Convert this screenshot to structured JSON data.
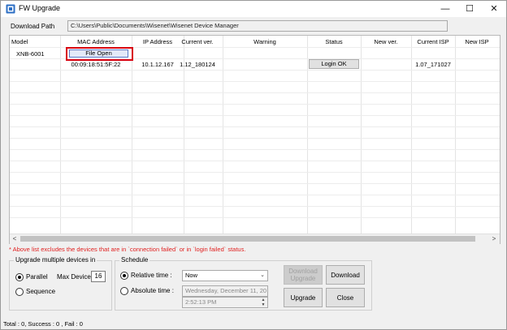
{
  "window": {
    "title": "FW Upgrade",
    "minimize_glyph": "—",
    "maximize_glyph": "☐",
    "close_glyph": "✕",
    "icon": "app-icon"
  },
  "download_path": {
    "label": "Download Path",
    "value": "C:\\Users\\Public\\Documents\\Wisenet\\Wisenet Device Manager"
  },
  "table": {
    "headers": [
      "Model",
      "MAC Address",
      "IP Address",
      "Current ver.",
      "Warning",
      "Status",
      "New ver.",
      "Current ISP",
      "New ISP"
    ],
    "row": {
      "model": "XNB-6001",
      "file_open_label": "File Open",
      "mac": "00:09:18:51:5F:22",
      "ip": "10.1.12.167",
      "current_ver": "1.12_180124",
      "status_button": "Login OK",
      "current_isp": "1.07_171027"
    },
    "scroll_left_glyph": "<",
    "scroll_right_glyph": ">"
  },
  "warning_note": "* Above list excludes the devices that are in `connection failed` or in `login failed` status.",
  "upgrade_group": {
    "title": "Upgrade multiple devices in",
    "parallel_label": "Parallel",
    "parallel_selected": true,
    "max_device_label": "Max Device",
    "max_device_value": "16",
    "sequence_label": "Sequence"
  },
  "schedule_group": {
    "title": "Schedule",
    "relative_label": "Relative time :",
    "relative_selected": true,
    "relative_value": "Now",
    "absolute_label": "Absolute time :",
    "absolute_date": "Wednesday,  December 11, 20",
    "absolute_time": "2:52:13 PM",
    "dropdown_glyph": "⌄",
    "spin_up": "▲",
    "spin_down": "▼"
  },
  "buttons": {
    "download_upgrade": "Download Upgrade",
    "download": "Download",
    "upgrade": "Upgrade",
    "close": "Close"
  },
  "status_bar": "Total : 0, Success : 0 , Fail : 0",
  "colors": {
    "highlight_border": "#d8000f",
    "warning_text": "#e0201f"
  }
}
